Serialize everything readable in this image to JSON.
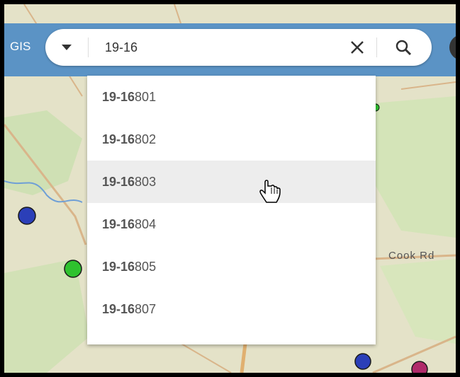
{
  "topbar": {
    "app_label": "GIS"
  },
  "search": {
    "value": "19-16",
    "clear_icon": "close-icon",
    "search_icon": "search-icon",
    "dropdown_icon": "caret-down-icon"
  },
  "suggestions": [
    {
      "match": "19-16",
      "rest": "801"
    },
    {
      "match": "19-16",
      "rest": "802"
    },
    {
      "match": "19-16",
      "rest": "803"
    },
    {
      "match": "19-16",
      "rest": "804"
    },
    {
      "match": "19-16",
      "rest": "805"
    },
    {
      "match": "19-16",
      "rest": "807"
    }
  ],
  "map": {
    "labels": [
      "Cook Rd"
    ],
    "colors": {
      "background": "#e4e2c8",
      "toolbar": "#5b93c5",
      "marker_blue": "#2b3fb8",
      "marker_green": "#2ec22e",
      "marker_magenta": "#b02a6a"
    }
  }
}
